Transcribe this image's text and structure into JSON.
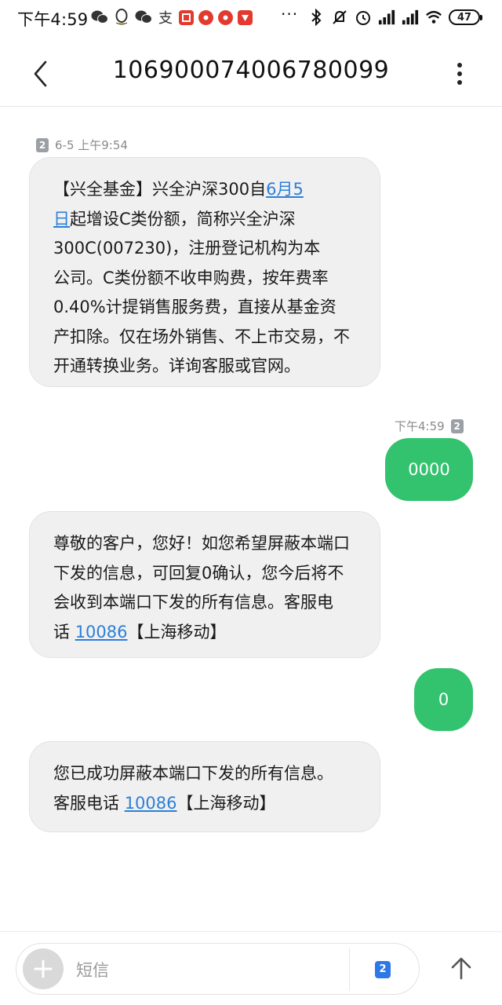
{
  "status_bar": {
    "time": "下午4:59",
    "dots": "···",
    "battery": "47",
    "left_icons": [
      "wechat-icon",
      "qq-icon",
      "wechat-icon",
      "alipay-icon",
      "app-red-icon",
      "app-red-circle-icon",
      "app-red-circle-icon",
      "app-red-icon"
    ],
    "right_icons": [
      "bluetooth-icon",
      "mute-icon",
      "alarm-icon",
      "signal-icon",
      "hd-signal-icon",
      "wifi-icon",
      "battery-icon"
    ]
  },
  "header": {
    "title": "106900074006780099"
  },
  "messages": [
    {
      "direction": "in",
      "sim": "2",
      "time": "6-5 上午9:54",
      "lines": [
        {
          "pre": "【兴全基金】兴全沪深300自",
          "link": "6月5"
        },
        {
          "link": "日",
          "post": "起增设C类份额，简称兴全沪深"
        },
        {
          "text": "300C(007230)，注册登记机构为本"
        },
        {
          "text": "公司。C类份额不收申购费，按年费率"
        },
        {
          "text": "0.40%计提销售服务费，直接从基金资"
        },
        {
          "text": "产扣除。仅在场外销售、不上市交易，不"
        },
        {
          "text": "开通转换业务。详询客服或官网。"
        }
      ]
    },
    {
      "direction": "out",
      "sim": "2",
      "time": "下午4:59",
      "text": "0000"
    },
    {
      "direction": "in",
      "lines": [
        {
          "text": "尊敬的客户，您好！如您希望屏蔽本端口"
        },
        {
          "text": "下发的信息，可回复0确认，您今后将不"
        },
        {
          "text": "会收到本端口下发的所有信息。客服电"
        },
        {
          "pre": "话 ",
          "link": "10086",
          "post": "【上海移动】"
        }
      ]
    },
    {
      "direction": "out",
      "text": "0"
    },
    {
      "direction": "in",
      "lines": [
        {
          "text": "您已成功屏蔽本端口下发的所有信息。"
        },
        {
          "pre": "客服电话 ",
          "link": "10086",
          "post": "【上海移动】"
        }
      ]
    }
  ],
  "composer": {
    "placeholder": "短信",
    "sim": "2"
  },
  "colors": {
    "outgoing_bubble": "#33c26e",
    "incoming_bubble": "#f0f0f0",
    "link": "#2b7fd8",
    "sim_select": "#2e78e6"
  }
}
